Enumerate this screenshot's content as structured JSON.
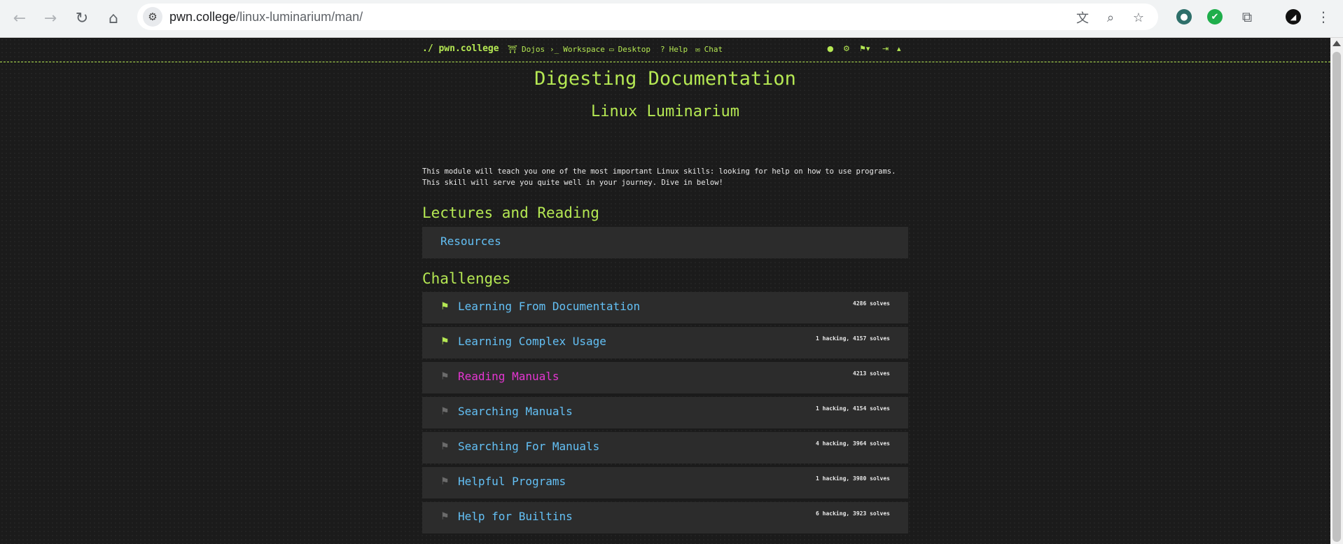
{
  "browser": {
    "url_host": "pwn.college",
    "url_path": "/linux-luminarium/man/",
    "back_icon": "←",
    "forward_icon": "→",
    "reload_icon": "↻",
    "home_icon": "⌂",
    "translate_icon": "文",
    "zoom_icon": "⌕",
    "star_icon": "☆",
    "extensions_icon": "⧉"
  },
  "nav": {
    "brand": "./ pwn.college",
    "links": [
      {
        "icon": "⛩",
        "label": "Dojos"
      },
      {
        "icon": "›_",
        "label": "Workspace"
      },
      {
        "icon": "▭",
        "label": "Desktop"
      },
      {
        "icon": "?",
        "label": "Help"
      },
      {
        "icon": "✉",
        "label": "Chat"
      }
    ]
  },
  "page": {
    "title": "Digesting Documentation",
    "subtitle": "Linux Luminarium",
    "description": "This module will teach you one of the most important Linux skills: looking for help on how to use programs. This skill will serve you quite well in your journey. Dive in below!",
    "lectures_heading": "Lectures and Reading",
    "resources_label": "Resources",
    "challenges_heading": "Challenges"
  },
  "challenges": [
    {
      "name": "Learning From Documentation",
      "solves": "4286 solves",
      "solved": true,
      "active": false
    },
    {
      "name": "Learning Complex Usage",
      "solves": "1 hacking, 4157 solves",
      "solved": true,
      "active": false
    },
    {
      "name": "Reading Manuals",
      "solves": "4213 solves",
      "solved": false,
      "active": true
    },
    {
      "name": "Searching Manuals",
      "solves": "1 hacking, 4154 solves",
      "solved": false,
      "active": false
    },
    {
      "name": "Searching For Manuals",
      "solves": "4 hacking, 3964 solves",
      "solved": false,
      "active": false
    },
    {
      "name": "Helpful Programs",
      "solves": "1 hacking, 3980 solves",
      "solved": false,
      "active": false
    },
    {
      "name": "Help for Builtins",
      "solves": "6 hacking, 3923 solves",
      "solved": false,
      "active": false
    }
  ],
  "colors": {
    "accent": "#b5e853",
    "link": "#63c0f5",
    "active": "#e536d2",
    "flag_solved": "#b5e853",
    "flag_unsolved": "#6b6b6b"
  }
}
